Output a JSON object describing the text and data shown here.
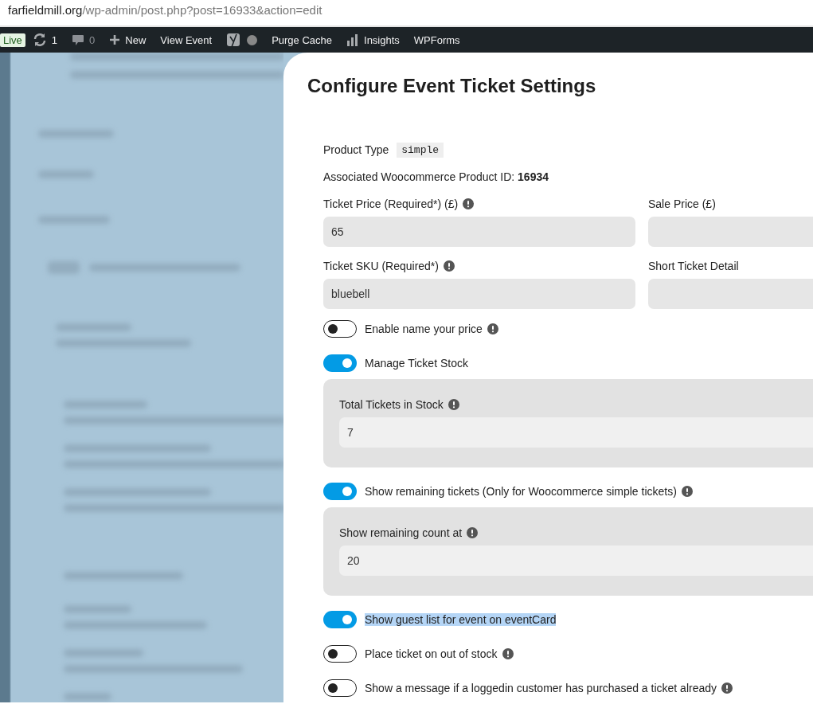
{
  "browser": {
    "url_host": "farfieldmill.org",
    "url_path": "/wp-admin/post.php?post=16933&action=edit"
  },
  "admin_bar": [
    {
      "kind": "live",
      "label": "Live"
    },
    {
      "kind": "updates",
      "label": "1"
    },
    {
      "kind": "comments",
      "label": "0"
    },
    {
      "kind": "new",
      "label": "New"
    },
    {
      "kind": "link",
      "label": "View Event"
    },
    {
      "kind": "logo"
    },
    {
      "kind": "status"
    },
    {
      "kind": "link",
      "label": "Purge Cache"
    },
    {
      "kind": "insights",
      "label": "Insights"
    },
    {
      "kind": "link",
      "label": "WPForms"
    }
  ],
  "modal": {
    "title": "Configure Event Ticket Settings",
    "product_type": {
      "label": "Product Type",
      "value": "simple"
    },
    "product_id": "Associated Woocommerce Product ID: **16934**",
    "fields": [
      {
        "label": "Ticket Price (Required*) (£)",
        "info": true,
        "value": "65"
      },
      {
        "label": "Sale Price (£)",
        "info": false
      },
      {
        "label": "Ticket SKU (Required*)",
        "info": true,
        "value": "bluebell"
      },
      {
        "label": "Short Ticket Detail",
        "info": false
      }
    ],
    "settings": [
      {
        "kind": "toggle",
        "label": "Enable name your price",
        "on": false,
        "info": true,
        "highlighted": false
      },
      {
        "kind": "toggle",
        "label": "Manage Ticket Stock",
        "on": true,
        "info": false,
        "highlighted": false
      },
      {
        "kind": "panel",
        "label": "Total Tickets in Stock",
        "info": true,
        "value": "7"
      },
      {
        "kind": "toggle",
        "label": "Show remaining tickets (Only for Woocommerce simple tickets)",
        "on": true,
        "info": true,
        "highlighted": false
      },
      {
        "kind": "panel",
        "label": "Show remaining count at",
        "info": true,
        "value": "20"
      },
      {
        "kind": "toggle",
        "label": "Show guest list for event on eventCard",
        "on": true,
        "info": false,
        "highlighted": true
      },
      {
        "kind": "toggle",
        "label": "Place ticket on out of stock",
        "on": false,
        "info": true,
        "highlighted": false
      },
      {
        "kind": "toggle",
        "label": "Show a message if a loggedin customer has purchased a ticket already",
        "on": false,
        "info": true,
        "highlighted": false
      }
    ]
  }
}
